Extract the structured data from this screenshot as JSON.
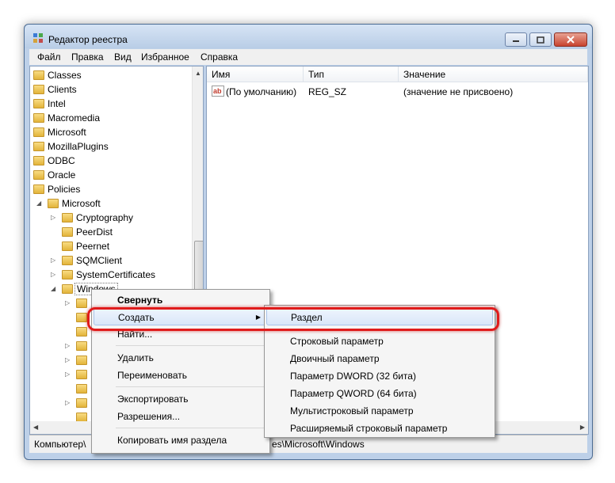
{
  "window": {
    "title": "Редактор реестра"
  },
  "menubar": [
    "Файл",
    "Правка",
    "Вид",
    "Избранное",
    "Справка"
  ],
  "tree": [
    {
      "label": "Classes"
    },
    {
      "label": "Clients"
    },
    {
      "label": "Intel"
    },
    {
      "label": "Macromedia"
    },
    {
      "label": "Microsoft"
    },
    {
      "label": "MozillaPlugins"
    },
    {
      "label": "ODBC"
    },
    {
      "label": "Oracle"
    },
    {
      "label": "Policies"
    },
    {
      "label": "Microsoft"
    },
    {
      "label": "Cryptography"
    },
    {
      "label": "PeerDist"
    },
    {
      "label": "Peernet"
    },
    {
      "label": "SQMClient"
    },
    {
      "label": "SystemCertificates"
    },
    {
      "label": "Windows"
    }
  ],
  "list": {
    "columns": [
      "Имя",
      "Тип",
      "Значение"
    ],
    "rows": [
      {
        "name": "(По умолчанию)",
        "type": "REG_SZ",
        "value": "(значение не присвоено)",
        "icon": "string-value-icon"
      }
    ]
  },
  "status": {
    "path_left": "Компьютер\\",
    "path_right": "es\\Microsoft\\Windows"
  },
  "context_menu": {
    "collapse": "Свернуть",
    "create": "Создать",
    "find": "Найти...",
    "delete": "Удалить",
    "rename": "Переименовать",
    "export": "Экспортировать",
    "permissions": "Разрешения...",
    "copy_key_name": "Копировать имя раздела"
  },
  "submenu": {
    "key": "Раздел",
    "string": "Строковый параметр",
    "binary": "Двоичный параметр",
    "dword": "Параметр DWORD (32 бита)",
    "qword": "Параметр QWORD (64 бита)",
    "multistring": "Мультистроковый параметр",
    "expandstring": "Расширяемый строковый параметр"
  },
  "colors": {
    "highlight_ring": "#e01b1b",
    "menu_highlight": "#d9e7f9"
  }
}
